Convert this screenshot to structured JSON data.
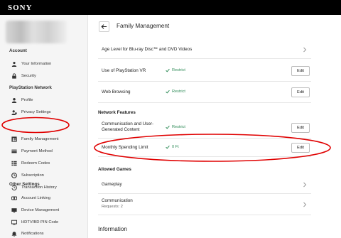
{
  "brand": "SONY",
  "sidebar": {
    "sections": [
      {
        "title": "Account",
        "items": [
          {
            "label": "Your Information",
            "icon": "user-icon"
          },
          {
            "label": "Security",
            "icon": "lock-icon"
          }
        ]
      },
      {
        "title": "PlayStation Network",
        "items": [
          {
            "label": "Profile",
            "icon": "profile-icon"
          },
          {
            "label": "Privacy Settings",
            "icon": "privacy-icon"
          },
          {
            "label": "Family Management",
            "icon": "family-icon"
          },
          {
            "label": "Payment Method",
            "icon": "card-icon"
          },
          {
            "label": "Redeem Codes",
            "icon": "code-icon"
          },
          {
            "label": "Subscription",
            "icon": "subscription-icon"
          },
          {
            "label": "Transaction History",
            "icon": "history-icon"
          }
        ]
      },
      {
        "title": "Other Settings",
        "items": [
          {
            "label": "Account Linking",
            "icon": "link-icon"
          },
          {
            "label": "Device Management",
            "icon": "device-icon"
          },
          {
            "label": "HDTV/BD PIN Code",
            "icon": "tv-icon"
          },
          {
            "label": "Notifications",
            "icon": "bell-icon"
          }
        ]
      }
    ]
  },
  "main": {
    "title": "Family Management",
    "rows": [
      {
        "label": "Age Level for Blu-ray Disc™ and DVD Videos"
      },
      {
        "label": "Use of PlayStation VR",
        "status": "Restrict",
        "action": "Edit"
      },
      {
        "label": "Web Browsing",
        "status": "Restrict",
        "action": "Edit"
      }
    ],
    "network_features": {
      "title": "Network Features",
      "rows": [
        {
          "label": "Communication and User-Generated Content",
          "status": "Restrict",
          "action": "Edit"
        },
        {
          "label": "Monthly Spending Limit",
          "status": "0 Ft",
          "action": "Edit"
        }
      ]
    },
    "allowed_games": {
      "title": "Allowed Games",
      "rows": [
        {
          "label": "Gameplay"
        },
        {
          "label": "Communication",
          "sub": "Requests: 2"
        }
      ]
    },
    "information_title": "Information"
  },
  "colors": {
    "accent_status": "#2e8b57",
    "annotation": "#e00000",
    "topbar": "#000000"
  }
}
